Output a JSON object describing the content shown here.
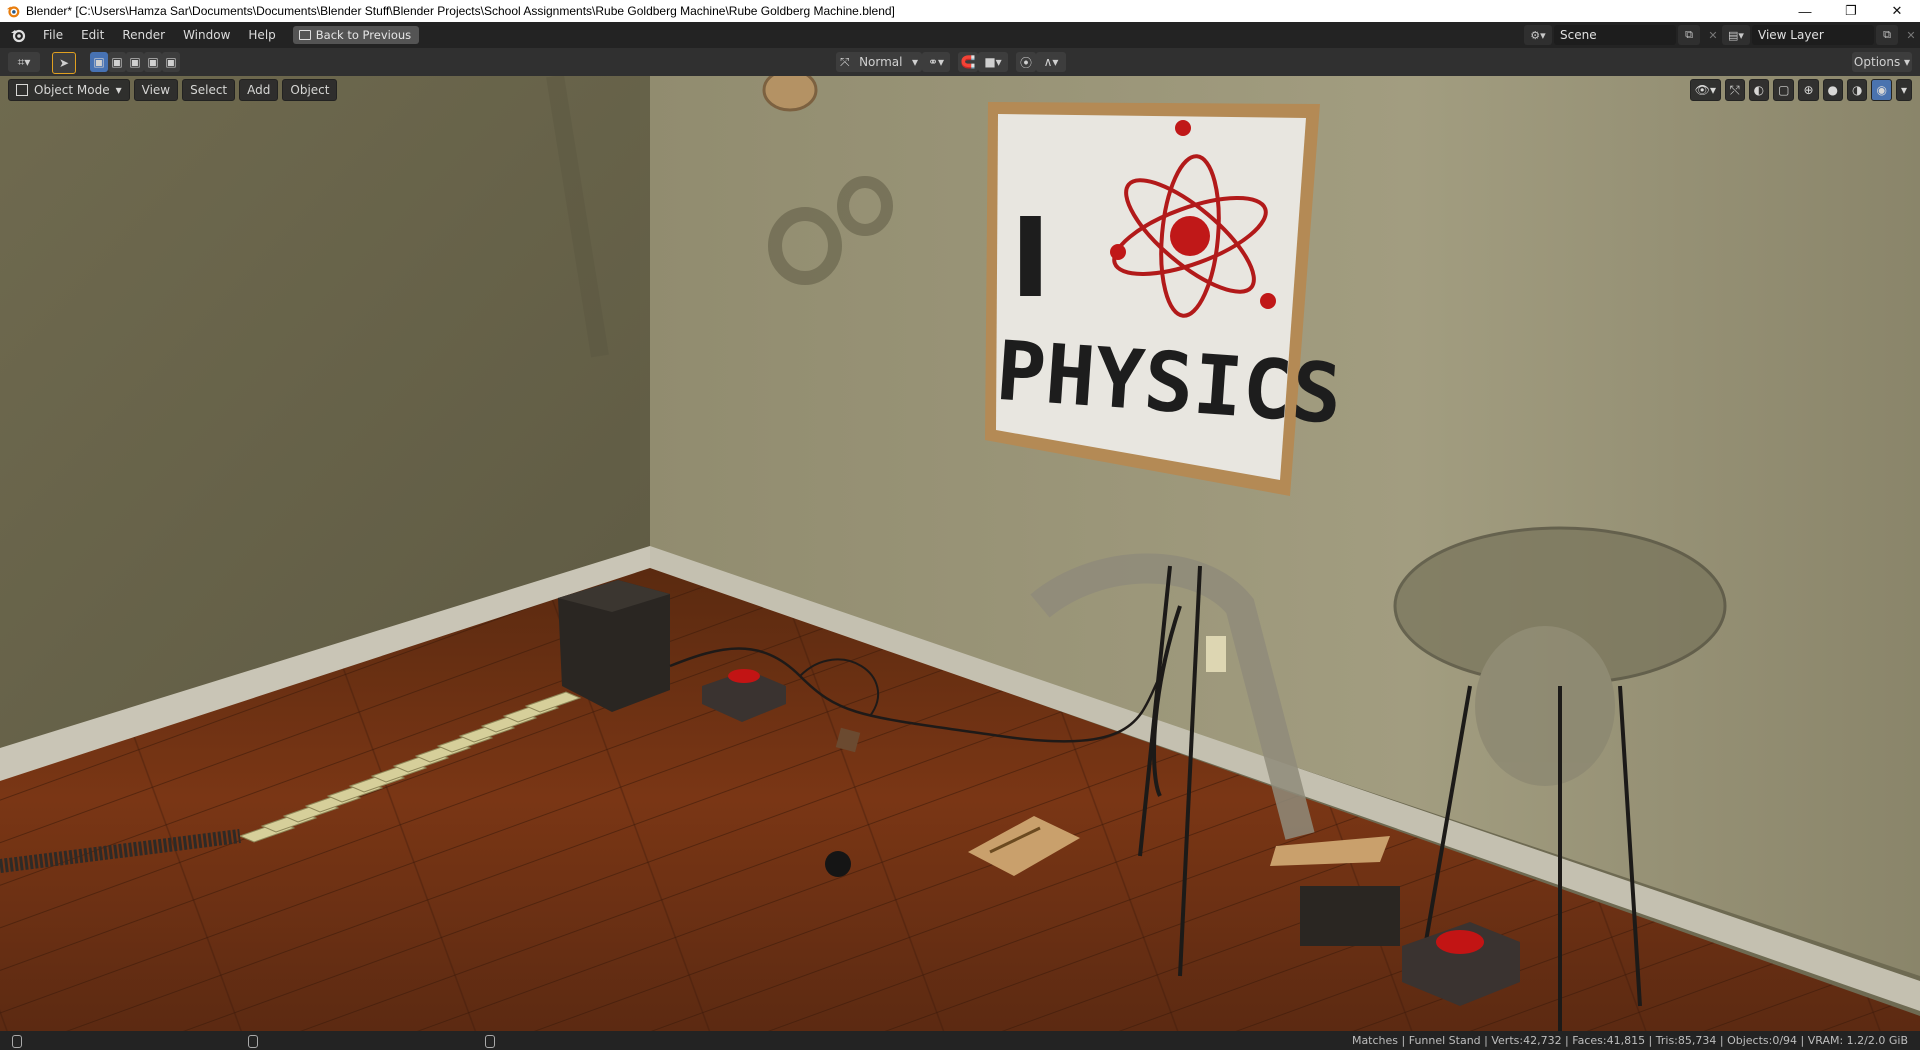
{
  "window": {
    "title": "Blender* [C:\\Users\\Hamza Sar\\Documents\\Documents\\Blender Stuff\\Blender Projects\\School Assignments\\Rube Goldberg Machine\\Rube Goldberg Machine.blend]",
    "controls": {
      "minimize": "—",
      "restore": "❐",
      "close": "✕"
    }
  },
  "menubar": {
    "items": [
      "File",
      "Edit",
      "Render",
      "Window",
      "Help"
    ],
    "back_button": "Back to Previous",
    "scene": "Scene",
    "view_layer": "View Layer"
  },
  "toolheader": {
    "orientation": "Normal",
    "options": "Options"
  },
  "viewport_header": {
    "mode": "Object Mode",
    "menus": [
      "View",
      "Select",
      "Add",
      "Object"
    ]
  },
  "scene_content": {
    "poster_line1": "I",
    "poster_line2": "PHYSICS"
  },
  "statusbar": {
    "info": "Matches | Funnel Stand | Verts:42,732 | Faces:41,815 | Tris:85,734 | Objects:0/94 | VRAM: 1.2/2.0 GiB"
  },
  "colors": {
    "accent": "#4772b3",
    "header_bg": "#303030",
    "menubar_bg": "#232323"
  }
}
